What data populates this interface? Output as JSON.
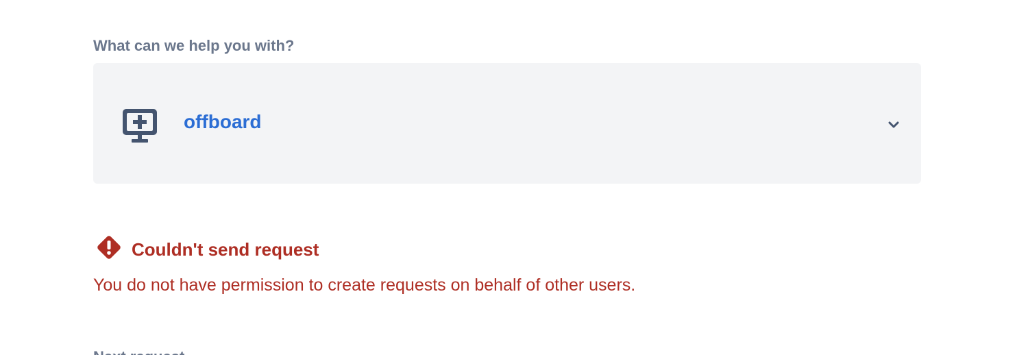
{
  "form": {
    "question_label": "What can we help you with?",
    "request_type": {
      "name": "offboard",
      "icon": "monitor-plus-icon",
      "dropdown_icon": "chevron-down-icon"
    }
  },
  "error": {
    "icon": "warning-diamond-icon",
    "title": "Couldn't send request",
    "message": "You do not have permission to create requests on behalf of other users."
  },
  "next_section": {
    "heading_partial": "Next request"
  },
  "colors": {
    "label_gray": "#6b778c",
    "select_background": "#f3f4f6",
    "link_blue": "#2b6dd4",
    "icon_slate": "#44546f",
    "error_red": "#ae2e24"
  }
}
